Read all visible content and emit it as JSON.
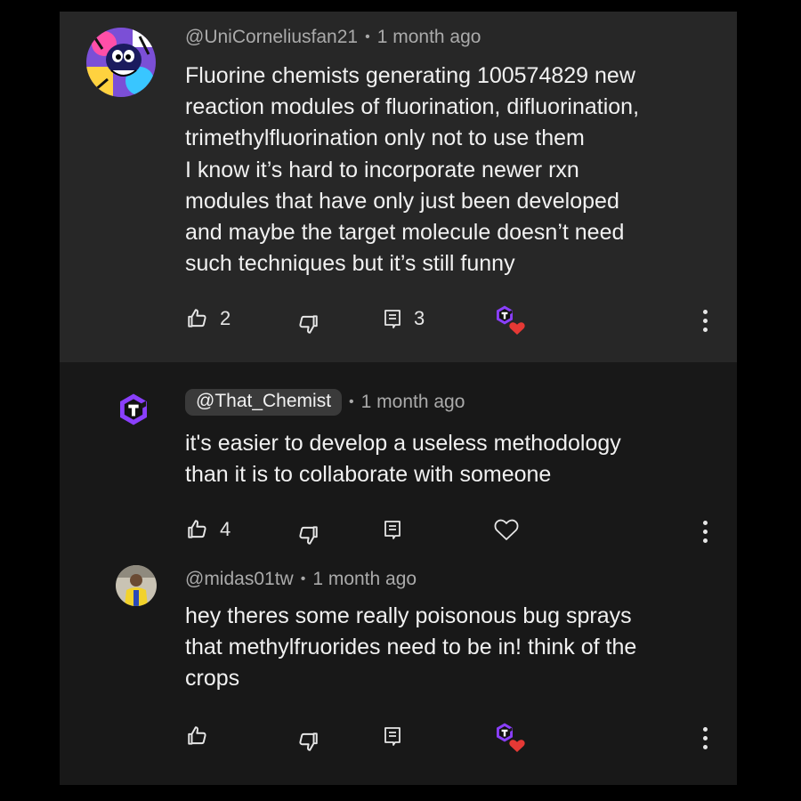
{
  "comments": [
    {
      "author": "@UniCorneliusfan21",
      "time": "1 month ago",
      "text": "Fluorine chemists generating 100574829 new\nreaction modules of fluorination, difluorination,\ntrimethylfluorination only not to use them\nI know it’s hard to incorporate newer rxn\nmodules that have only just been developed\nand maybe the target molecule doesn’t need\nsuch techniques but it’s still funny",
      "likes": "2",
      "replies": "3",
      "creator_hearted": true,
      "avatar_icon": "cartoon-character-avatar"
    },
    {
      "author": "@That_Chemist",
      "time": "1 month ago",
      "text": "it's easier to develop a useless methodology\nthan it is to collaborate with someone",
      "likes": "4",
      "is_creator": true,
      "avatar_icon": "channel-hexagon-logo"
    },
    {
      "author": "@midas01tw",
      "time": "1 month ago",
      "text": "hey theres some really poisonous bug sprays\nthat methylfruorides need to be in! think of the\ncrops",
      "creator_hearted": true,
      "avatar_icon": "person-photo-avatar"
    }
  ],
  "colors": {
    "panel_top": "#272727",
    "panel_replies": "#181818",
    "creator_logo_purple": "#8a3ffc",
    "heart_red": "#e53935",
    "meta_gray": "#aaaaaa"
  },
  "icons": [
    "thumbs-up-icon",
    "thumbs-down-icon",
    "reply-icon",
    "heart-icon",
    "more-vertical-icon",
    "creator-heart-badge-icon"
  ]
}
